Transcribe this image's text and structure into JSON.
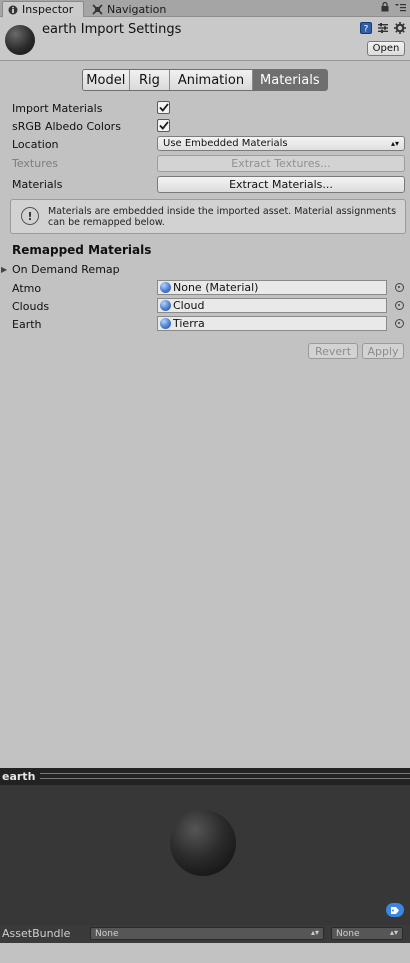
{
  "tabs": {
    "inspector": "Inspector",
    "navigation": "Navigation"
  },
  "header": {
    "title": "earth Import Settings",
    "open_label": "Open"
  },
  "toolbar": {
    "model": "Model",
    "rig": "Rig",
    "animation": "Animation",
    "materials": "Materials",
    "selected": "Materials"
  },
  "settings": {
    "import_materials_label": "Import Materials",
    "import_materials_checked": true,
    "srgb_label": "sRGB Albedo Colors",
    "srgb_checked": true,
    "location_label": "Location",
    "location_value": "Use Embedded Materials",
    "textures_label": "Textures",
    "extract_textures": "Extract Textures...",
    "materials_label": "Materials",
    "extract_materials": "Extract Materials..."
  },
  "help": {
    "text": "Materials are embedded inside the imported asset. Material assignments can be remapped below."
  },
  "remapped": {
    "title": "Remapped Materials",
    "on_demand": "On Demand Remap",
    "rows": [
      {
        "label": "Atmo",
        "value": "None (Material)"
      },
      {
        "label": "Clouds",
        "value": "Cloud"
      },
      {
        "label": "Earth",
        "value": "Tierra"
      }
    ]
  },
  "actions": {
    "revert": "Revert",
    "apply": "Apply"
  },
  "preview": {
    "title": "earth"
  },
  "asset_bundle": {
    "label": "AssetBundle",
    "name_value": "None",
    "variant_value": "None"
  },
  "colors": {
    "accent": "#3a86e0",
    "selected_tab": "#6f6f6f",
    "preview_bg": "#373737"
  }
}
